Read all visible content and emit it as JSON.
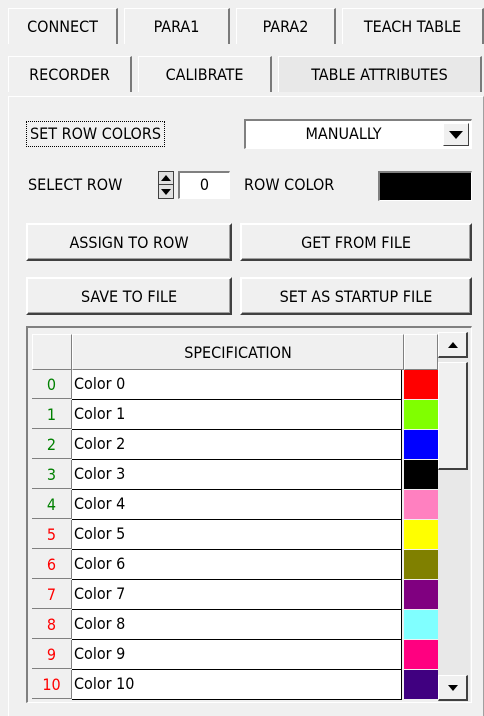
{
  "tabs_row1": [
    {
      "label": "CONNECT"
    },
    {
      "label": "PARA1"
    },
    {
      "label": "PARA2"
    },
    {
      "label": "TEACH TABLE"
    }
  ],
  "tabs_row2": [
    {
      "label": "RECORDER"
    },
    {
      "label": "CALIBRATE"
    },
    {
      "label": "TABLE ATTRIBUTES"
    }
  ],
  "set_row_colors": {
    "label": "SET ROW COLORS",
    "value": "MANUALLY"
  },
  "select_row": {
    "label": "SELECT ROW",
    "value": "0"
  },
  "row_color": {
    "label": "ROW COLOR",
    "color": "#000000"
  },
  "buttons": {
    "assign": "ASSIGN TO ROW",
    "get_file": "GET FROM FILE",
    "save_file": "SAVE TO FILE",
    "startup": "SET AS STARTUP FILE"
  },
  "table": {
    "header": "SPECIFICATION",
    "rows": [
      {
        "num": "0",
        "spec": "Color 0",
        "color": "#ff0000",
        "num_color": "#008000"
      },
      {
        "num": "1",
        "spec": "Color 1",
        "color": "#80ff00",
        "num_color": "#008000"
      },
      {
        "num": "2",
        "spec": "Color 2",
        "color": "#0000ff",
        "num_color": "#008000"
      },
      {
        "num": "3",
        "spec": "Color 3",
        "color": "#000000",
        "num_color": "#008000"
      },
      {
        "num": "4",
        "spec": "Color 4",
        "color": "#ff80c0",
        "num_color": "#008000"
      },
      {
        "num": "5",
        "spec": "Color 5",
        "color": "#ffff00",
        "num_color": "#ff0000"
      },
      {
        "num": "6",
        "spec": "Color 6",
        "color": "#808000",
        "num_color": "#ff0000"
      },
      {
        "num": "7",
        "spec": "Color 7",
        "color": "#800080",
        "num_color": "#ff0000"
      },
      {
        "num": "8",
        "spec": "Color 8",
        "color": "#80ffff",
        "num_color": "#ff0000"
      },
      {
        "num": "9",
        "spec": "Color 9",
        "color": "#ff0080",
        "num_color": "#ff0000"
      },
      {
        "num": "10",
        "spec": "Color 10",
        "color": "#400080",
        "num_color": "#ff0000"
      }
    ]
  }
}
